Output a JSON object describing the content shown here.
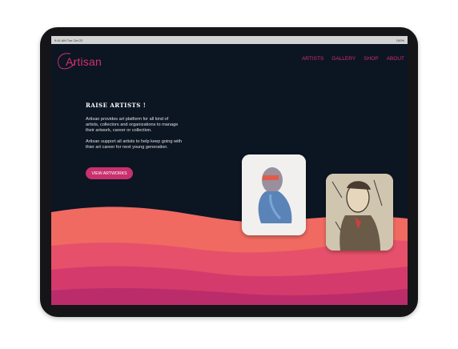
{
  "status_bar": {
    "time": "9:41 AM   Tue Oct 22",
    "right": "100%"
  },
  "brand": {
    "name": "Artisan"
  },
  "nav": {
    "items": [
      "ARTISTS",
      "GALLERY",
      "SHOP",
      "ABOUT"
    ]
  },
  "hero": {
    "title": "RAISE ARTISTS !",
    "p1_line1": "Artisan provides art platform for all kind of",
    "p1_line2": "artists, collectors and organizations to manage",
    "p1_line3": "their artwork, career or collection.",
    "p2_line1": "Artisan support all artists to help keep going with",
    "p2_line2": "thier art career for next young generation.",
    "cta": "VIEW ARTWORKS"
  },
  "colors": {
    "accent": "#d0306e",
    "background": "#0c1522",
    "wave_coral": "#f06a62",
    "wave_pink": "#e0456a",
    "wave_magenta": "#c8306e"
  }
}
